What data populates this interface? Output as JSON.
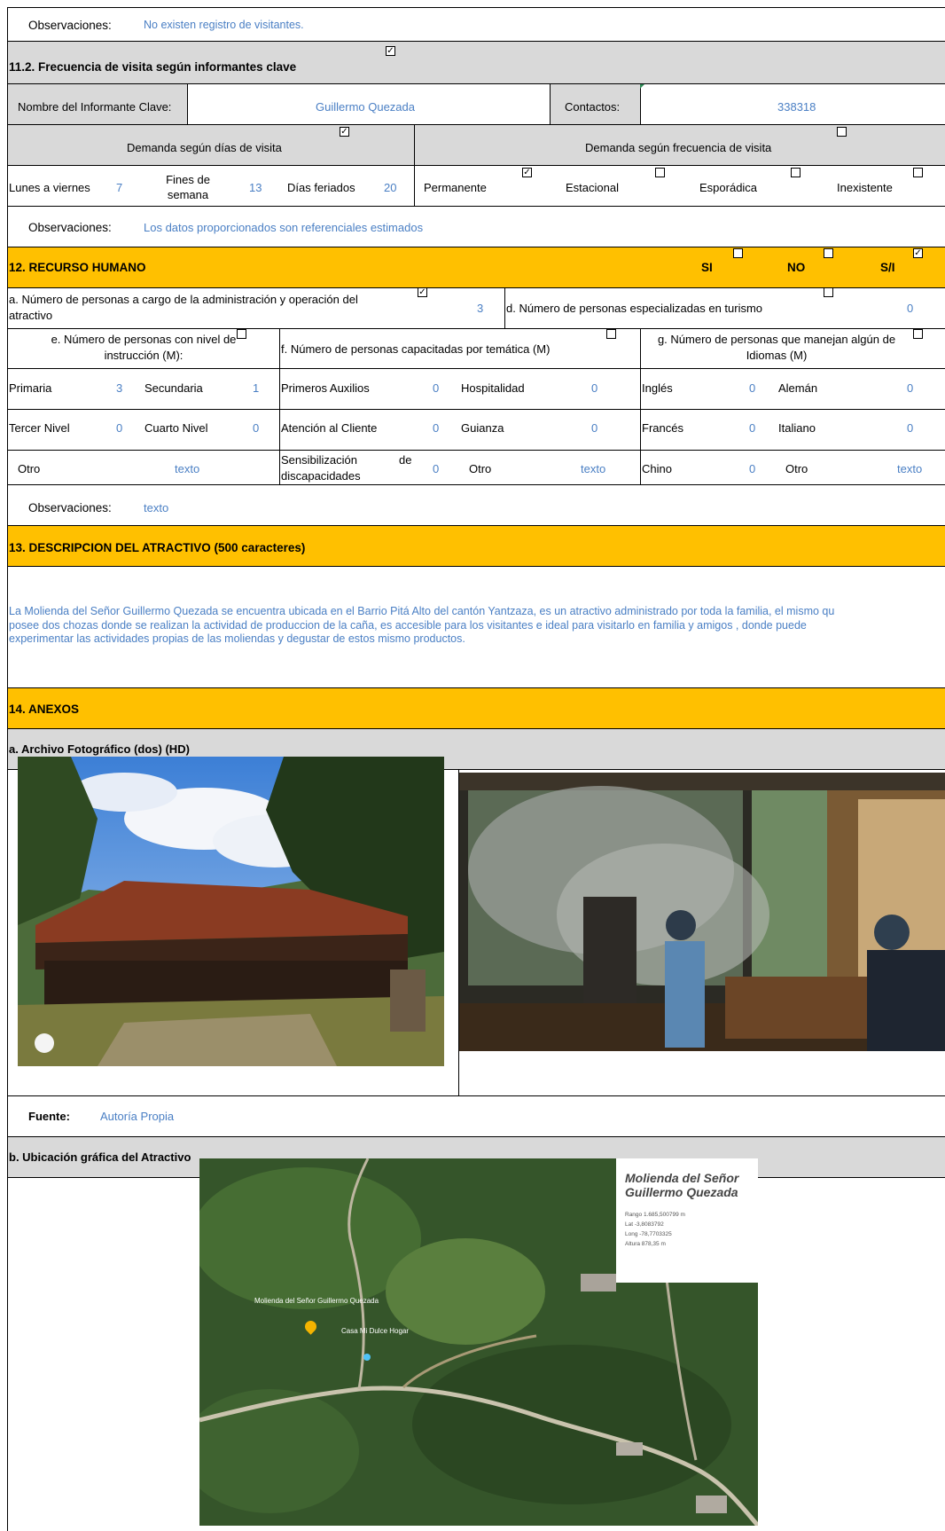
{
  "obs_visitantes": {
    "label": "Observaciones:",
    "value": "No existen registro de visitantes."
  },
  "s11_2": {
    "title": "11.2. Frecuencia de visita según informantes clave",
    "informante_label": "Nombre del Informante Clave:",
    "informante_value": "Guillermo Quezada",
    "contactos_label": "Contactos:",
    "contactos_value": "338318",
    "demanda_dias": "Demanda según  días de visita",
    "demanda_frecuencia": "Demanda según frecuencia de visita",
    "lunes_label": "Lunes a viernes",
    "lunes_value": "7",
    "fines_label_1": "Fines de",
    "fines_label_2": "semana",
    "fines_value": "13",
    "feriados_label": "Días feriados",
    "feriados_value": "20",
    "freq": [
      "Permanente",
      "Estacional",
      "Esporádica",
      "Inexistente"
    ],
    "obs_label": "Observaciones:",
    "obs_value": "Los datos proporcionados son referenciales estimados"
  },
  "s12": {
    "title": "12. RECURSO HUMANO",
    "si": "SI",
    "no": "NO",
    "si_label": "S/I",
    "a_label_1": "a. Número de personas a cargo de la administración y operación del",
    "a_label_2": "atractivo",
    "a_value": "3",
    "d_label": "d. Número de personas especializadas en turismo",
    "d_value": "0",
    "e_label_1": "e. Número de personas con nivel de",
    "e_label_2": "instrucción (M):",
    "f_label": "f. Número de personas capacitadas por temática (M)",
    "g_label_1": "g. Número de personas que manejan algún de",
    "g_label_2": "Idiomas (M)",
    "primaria": "Primaria",
    "primaria_v": "3",
    "secundaria": "Secundaria",
    "secundaria_v": "1",
    "tercer": "Tercer Nivel",
    "tercer_v": "0",
    "cuarto": "Cuarto Nivel",
    "cuarto_v": "0",
    "otro_e": "Otro",
    "otro_e_v": "texto",
    "primeros": "Primeros Auxilios",
    "primeros_v": "0",
    "hospitalidad": "Hospitalidad",
    "hospitalidad_v": "0",
    "atencion": "Atención al Cliente",
    "atencion_v": "0",
    "guianza": "Guianza",
    "guianza_v": "0",
    "sensi_1": "Sensibilización",
    "sensi_de": "de",
    "sensi_2": "discapacidades",
    "sensi_v": "0",
    "otro_f": "Otro",
    "otro_f_v": "texto",
    "ingles": "Inglés",
    "ingles_v": "0",
    "aleman": "Alemán",
    "aleman_v": "0",
    "frances": "Francés",
    "frances_v": "0",
    "italiano": "Italiano",
    "italiano_v": "0",
    "chino": "Chino",
    "chino_v": "0",
    "otro_g": "Otro",
    "otro_g_v": "texto",
    "obs_label": "Observaciones:",
    "obs_value": "texto"
  },
  "s13": {
    "title": "13. DESCRIPCION DEL ATRACTIVO (500 caracteres)",
    "line1": "La Molienda del Señor Guillermo Quezada se encuentra ubicada en el Barrio Pitá Alto del cantón Yantzaza, es un atractivo administrado por toda la familia, el mismo qu",
    "line2": "posee dos chozas donde se realizan la actividad de produccion de la caña, es accesible para los visitantes e ideal para visitarlo en familia y amigos , donde puede",
    "line3": "experimentar las actividades propias de las moliendas  y degustar de estos mismo productos."
  },
  "s14": {
    "title": "14. ANEXOS",
    "foto_title": "a. Archivo Fotográfico (dos) (HD)",
    "fuente_label": "Fuente:",
    "fuente_value": "Autoría Propia",
    "ubic_title": "b. Ubicación gráfica del Atractivo"
  },
  "map": {
    "card_title_1": "Molienda del Señor",
    "card_title_2": "Guillermo Quezada",
    "rango": "Rango  1.685,500799 m",
    "lat": "Lat  -3,8083792",
    "long": "Long  -78,7703325",
    "altura": "Altura  878,35 m",
    "pin_label": "Molienda del Señor Guillermo Quezada",
    "place_label": "Casa Mi Dulce Hogar"
  },
  "colors": {
    "section_orange": "#ffc000",
    "header_gray": "#d9d9d9",
    "value_blue": "#4a7fc4"
  }
}
